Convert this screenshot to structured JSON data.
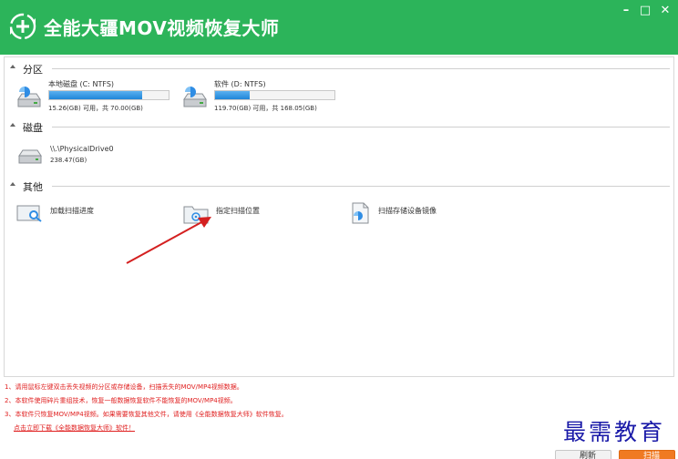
{
  "app": {
    "title": "全能大疆MOV视频恢复大师"
  },
  "window_controls": {
    "minimize": "–",
    "maximize": "□",
    "close": "✕"
  },
  "sections": {
    "partition": "分区",
    "disk": "磁盘",
    "other": "其他"
  },
  "partitions": [
    {
      "name": "本地磁盘 (C: NTFS)",
      "capacity": "15.26(GB) 可用，共 70.00(GB)",
      "used_fraction": 0.78
    },
    {
      "name": "软件 (D: NTFS)",
      "capacity": "119.70(GB) 可用，共 168.05(GB)",
      "used_fraction": 0.29
    }
  ],
  "disks": [
    {
      "name": "\\\\.\\PhysicalDrive0",
      "capacity": "238.47(GB)"
    }
  ],
  "other_items": [
    {
      "label": "加载扫描进度",
      "icon": "magnifier-icon"
    },
    {
      "label": "指定扫描位置",
      "icon": "folder-target-icon"
    },
    {
      "label": "扫描存储设备镜像",
      "icon": "disk-image-icon"
    }
  ],
  "notes": [
    "1、请用鼠标左键双击丢失视频的分区或存储设备，扫描丢失的MOV/MP4视频数据。",
    "2、本软件使用碎片重组技术，恢复一般数据恢复软件不能恢复的MOV/MP4视频。",
    "3、本软件只恢复MOV/MP4视频。如果需要恢复其他文件，请使用《全能数据恢复大师》软件恢复。"
  ],
  "download_link": "点击立即下载《全能数据恢复大师》软件！",
  "watermark": "最需教育",
  "buttons": {
    "refresh": "刷新",
    "scan": "扫描"
  },
  "colors": {
    "title_bar": "#2cb45a",
    "bar_fill": "#1f86d8",
    "note_text": "#e02020",
    "arrow": "#d42020",
    "scan_button": "#f07a22"
  }
}
